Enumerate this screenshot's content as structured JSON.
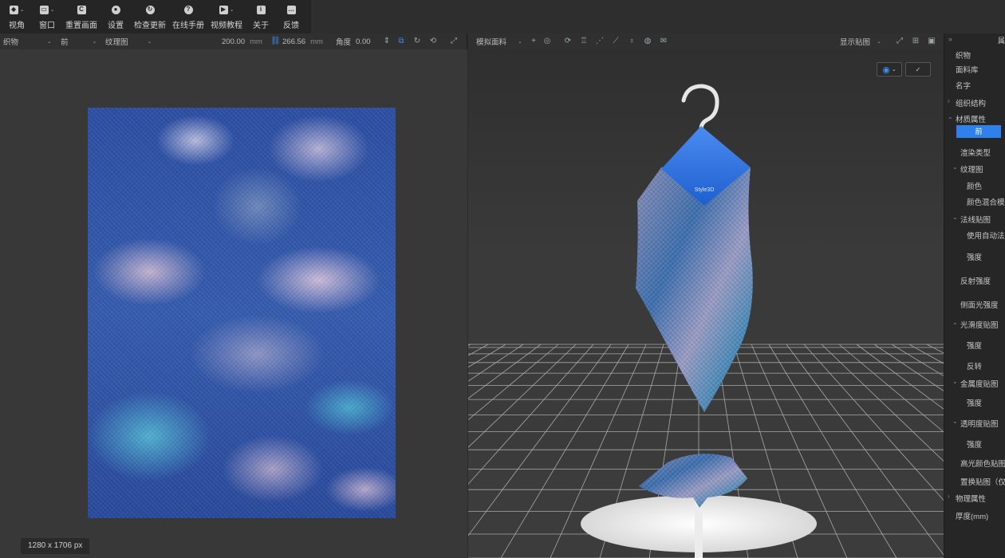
{
  "toolbar": [
    {
      "name": "view-button",
      "label": "视角",
      "icon": "cube-icon",
      "caret": true
    },
    {
      "name": "window-button",
      "label": "窗口",
      "icon": "window-icon",
      "caret": true
    },
    {
      "name": "reset-view-button",
      "label": "重置画面",
      "icon": "reset-icon",
      "caret": false
    },
    {
      "name": "settings-button",
      "label": "设置",
      "icon": "gear-icon",
      "caret": false
    },
    {
      "name": "check-update-button",
      "label": "检查更新",
      "icon": "refresh-icon",
      "caret": false
    },
    {
      "name": "online-manual-button",
      "label": "在线手册",
      "icon": "help-icon",
      "caret": false
    },
    {
      "name": "video-tutorial-button",
      "label": "视频教程",
      "icon": "play-icon",
      "caret": true
    },
    {
      "name": "about-button",
      "label": "关于",
      "icon": "info-icon",
      "caret": false
    },
    {
      "name": "feedback-button",
      "label": "反馈",
      "icon": "chat-icon",
      "caret": false
    }
  ],
  "editor": {
    "fabric_select": "织物",
    "side_select": "前",
    "map_select": "纹理图",
    "width": "200.00",
    "height": "266.56",
    "unit": "mm",
    "angle_label": "角度",
    "angle_value": "0.00",
    "image_size": "1280 x 1706 px"
  },
  "viewport": {
    "mode_select": "模拟面料",
    "display_select": "显示贴图",
    "hanger_logo": "Style3D",
    "grid_color": "#a9a9a9",
    "accent": "#2f80ed"
  },
  "sidebar": {
    "tab_title": "属",
    "rows": [
      {
        "label": "织物",
        "indent": 0,
        "arrow": ""
      },
      {
        "label": "面料库",
        "indent": 0,
        "arrow": ""
      },
      {
        "label": "名字",
        "indent": 0,
        "arrow": ""
      },
      {
        "label": "组织结构",
        "indent": 0,
        "arrow": "›"
      },
      {
        "label": "材质属性",
        "indent": 0,
        "arrow": "⌄"
      },
      {
        "label": "前",
        "indent": 0,
        "arrow": "",
        "active": true
      },
      {
        "label": "渲染类型",
        "indent": 1,
        "arrow": ""
      },
      {
        "label": "纹理图",
        "indent": 1,
        "arrow": "⌄"
      },
      {
        "label": "颜色",
        "indent": 2,
        "arrow": ""
      },
      {
        "label": "颜色混合模式",
        "indent": 2,
        "arrow": ""
      },
      {
        "label": "法线贴图",
        "indent": 1,
        "arrow": "⌄"
      },
      {
        "label": "使用自动法线",
        "indent": 2,
        "arrow": ""
      },
      {
        "label": "强度",
        "indent": 2,
        "arrow": ""
      },
      {
        "label": "反射强度",
        "indent": 1,
        "arrow": ""
      },
      {
        "label": "侧面光强度",
        "indent": 1,
        "arrow": ""
      },
      {
        "label": "光滑度贴图",
        "indent": 1,
        "arrow": "⌄"
      },
      {
        "label": "强度",
        "indent": 2,
        "arrow": ""
      },
      {
        "label": "反转",
        "indent": 2,
        "arrow": ""
      },
      {
        "label": "金属度贴图",
        "indent": 1,
        "arrow": "⌄"
      },
      {
        "label": "强度",
        "indent": 2,
        "arrow": ""
      },
      {
        "label": "透明度贴图",
        "indent": 1,
        "arrow": "⌄"
      },
      {
        "label": "强度",
        "indent": 2,
        "arrow": ""
      },
      {
        "label": "高光颜色贴图",
        "indent": 1,
        "arrow": ""
      },
      {
        "label": "置换贴图（仅",
        "indent": 1,
        "arrow": ""
      },
      {
        "label": "物理属性",
        "indent": 0,
        "arrow": "›"
      },
      {
        "label": "厚度(mm)",
        "indent": 0,
        "arrow": ""
      }
    ]
  }
}
